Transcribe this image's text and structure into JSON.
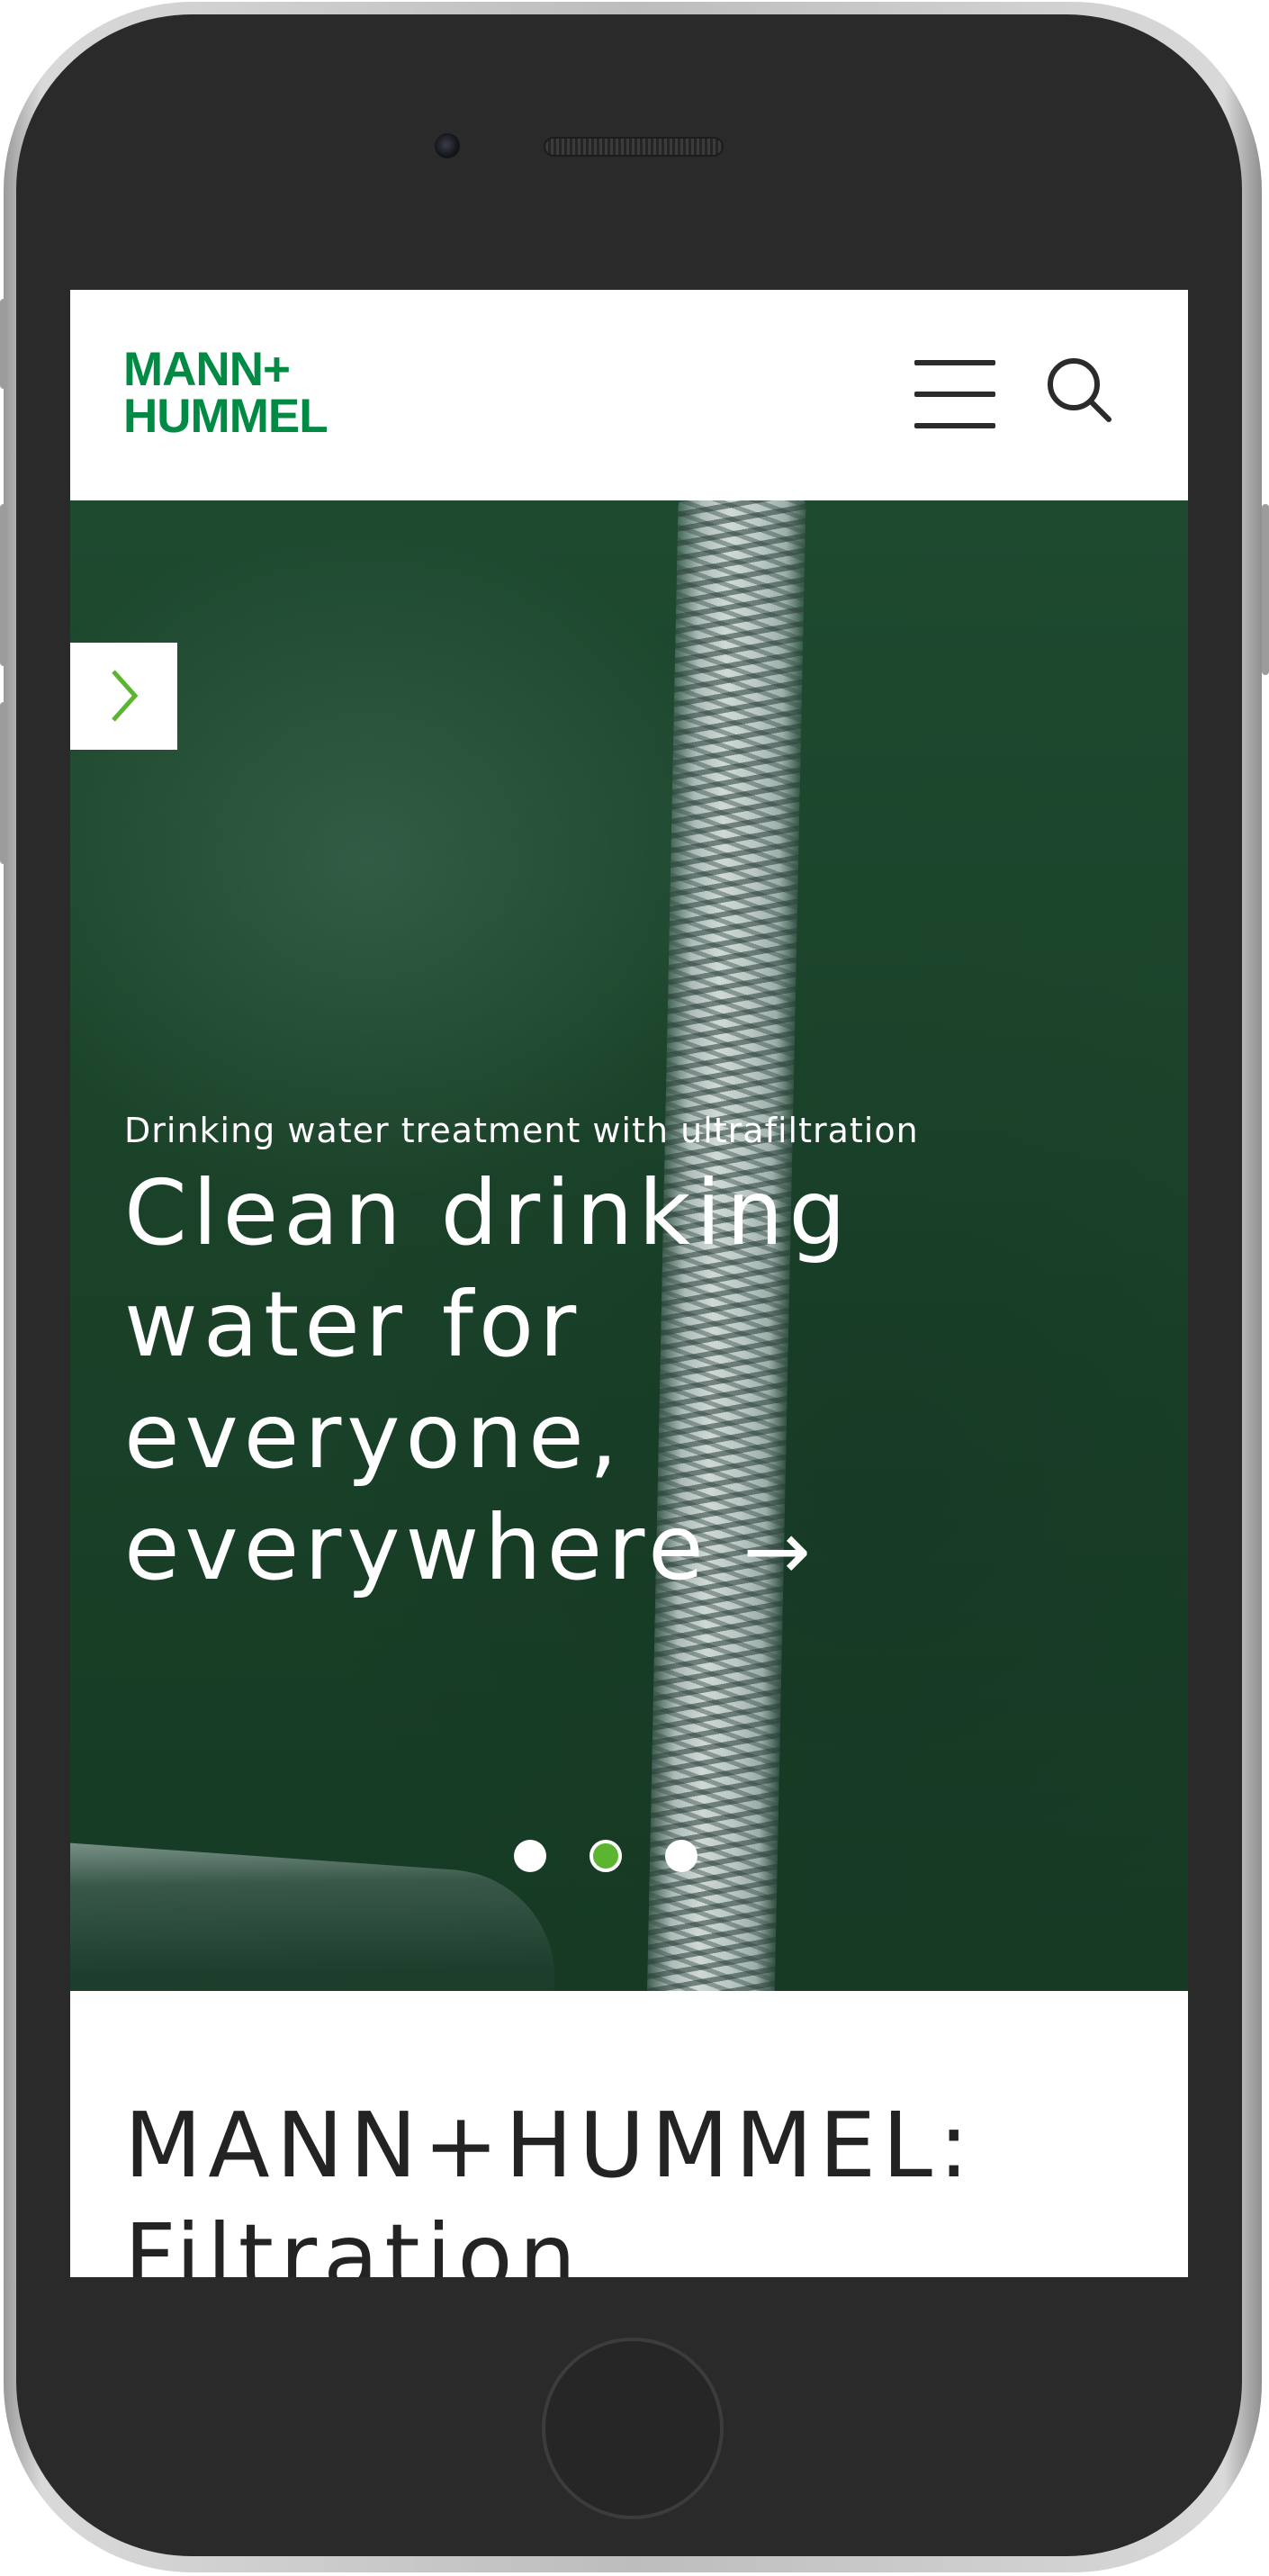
{
  "header": {
    "logo_line1": "MANN+",
    "logo_line2": "HUMMEL",
    "menu_icon": "hamburger-menu-icon",
    "search_icon": "search-icon",
    "brand_color": "#008a43"
  },
  "hero": {
    "eyebrow": "Drinking water treatment with ultrafiltration",
    "headline": "Clean drinking water for everyone, everywhere",
    "headline_arrow": "→",
    "prev_icon": "chevron-right-icon",
    "slides_total": 3,
    "active_slide": 2,
    "dot_colors": {
      "active": "#5bb531",
      "inactive": "#ffffff"
    }
  },
  "section": {
    "title": "MANN+HUMMEL: Filtration"
  }
}
